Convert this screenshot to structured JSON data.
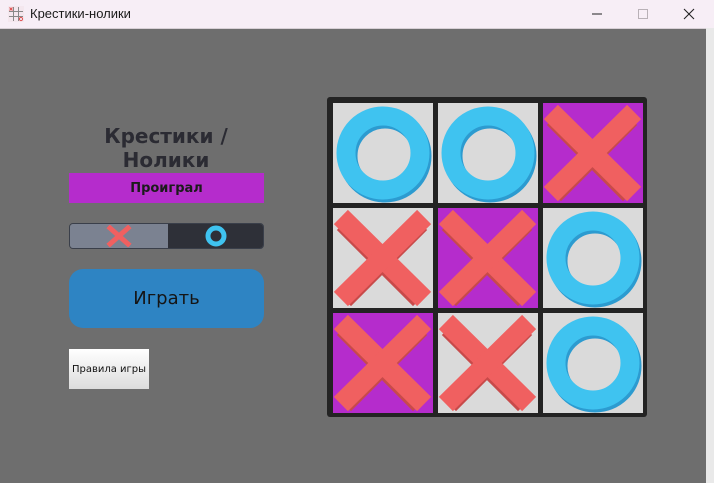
{
  "window": {
    "title": "Крестики-нолики"
  },
  "heading": "Крестики / Нолики",
  "status": {
    "text": "Проиграл",
    "color": "#b52ccc"
  },
  "mode_toggle": {
    "options": [
      "x-icon",
      "o-icon"
    ],
    "selected": "x"
  },
  "play_button": {
    "label": "Играть",
    "color": "#2e84c3"
  },
  "rules_button": {
    "label": "Правила игры"
  },
  "board": {
    "cells": [
      {
        "mark": "O",
        "highlight": false
      },
      {
        "mark": "O",
        "highlight": false
      },
      {
        "mark": "X",
        "highlight": true
      },
      {
        "mark": "X",
        "highlight": false
      },
      {
        "mark": "X",
        "highlight": true
      },
      {
        "mark": "O",
        "highlight": false
      },
      {
        "mark": "X",
        "highlight": true
      },
      {
        "mark": "X",
        "highlight": false
      },
      {
        "mark": "O",
        "highlight": false
      }
    ],
    "colors": {
      "cell": "#dadada",
      "highlight": "#b52ccc",
      "x": "#f06060",
      "x_shade": "#c84a4a",
      "o": "#3fc3f0",
      "o_shade": "#2c9bd0"
    }
  }
}
